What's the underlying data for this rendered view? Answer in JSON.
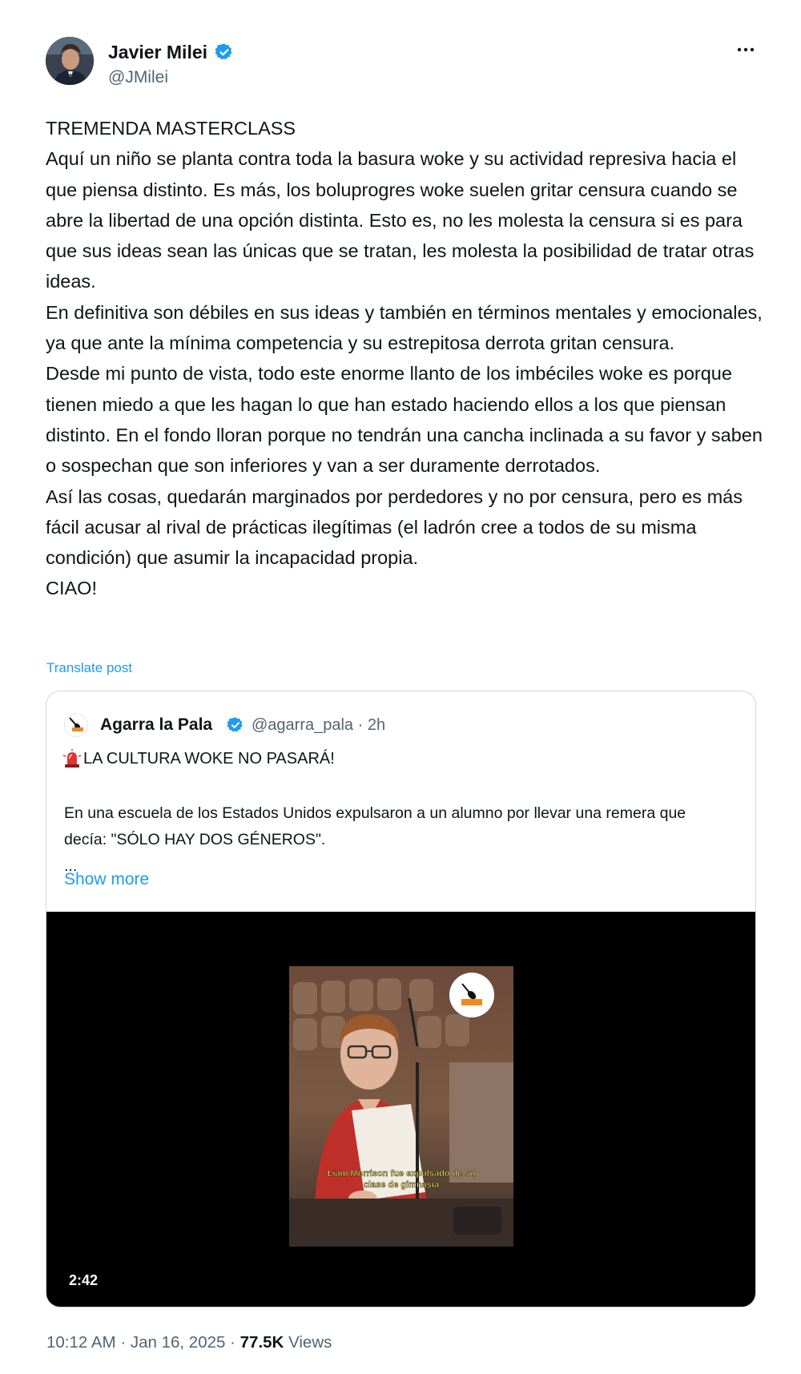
{
  "author": {
    "name": "Javier Milei",
    "handle": "@JMilei",
    "verified_color": "#1d9bf0"
  },
  "post": {
    "paragraphs": [
      "TREMENDA MASTERCLASS",
      "Aquí un niño se planta contra toda la basura woke y su actividad represiva hacia el que piensa distinto. Es más, los boluprogres woke suelen gritar censura cuando se abre la libertad de una opción distinta. Esto es, no les molesta la censura si es para que sus ideas sean las únicas que se tratan, les molesta la posibilidad de tratar otras ideas.",
      "En definitiva son débiles en sus ideas y también en términos mentales y emocionales, ya que ante la mínima competencia y su estrepitosa derrota gritan censura.",
      "Desde mi punto de vista, todo este enorme llanto de los imbéciles woke es porque tienen miedo a que les hagan lo que han estado haciendo ellos a los que piensan distinto. En el fondo lloran porque no tendrán una cancha inclinada a su favor y saben o sospechan que son inferiores y van a ser duramente derrotados.",
      "Así las cosas, quedarán marginados por perdedores y no por censura, pero es más fácil acusar al rival de prácticas ilegítimas (el ladrón cree a todos de su misma condición) que asumir la incapacidad propia.",
      "CIAO!"
    ],
    "translate_label": "Translate post"
  },
  "quote": {
    "name": "Agarra la Pala",
    "meta": "@agarra_pala · 2h",
    "headline": "LA CULTURA WOKE NO PASARÁ!",
    "body": "En una escuela de los Estados Unidos expulsaron a un alumno por llevar una remera que decía: \"SÓLO HAY DOS GÉNEROS\".",
    "ellipsis": "...",
    "show_more_label": "Show more",
    "video": {
      "duration": "2:42",
      "logo_text": "AGARRA LA PALA",
      "caption": "Liam Morrison fue expulsado de su clase de gimnasia"
    }
  },
  "footer": {
    "time": "10:12 AM",
    "date": "Jan 16, 2025",
    "views_count": "77.5K",
    "views_label": "Views"
  },
  "colors": {
    "link": "#1d9bf0",
    "secondary_text": "#536471",
    "border": "#cfd9de"
  },
  "icons": [
    "verified-badge-icon",
    "more-options-icon",
    "siren-icon",
    "shovel-logo-icon"
  ]
}
